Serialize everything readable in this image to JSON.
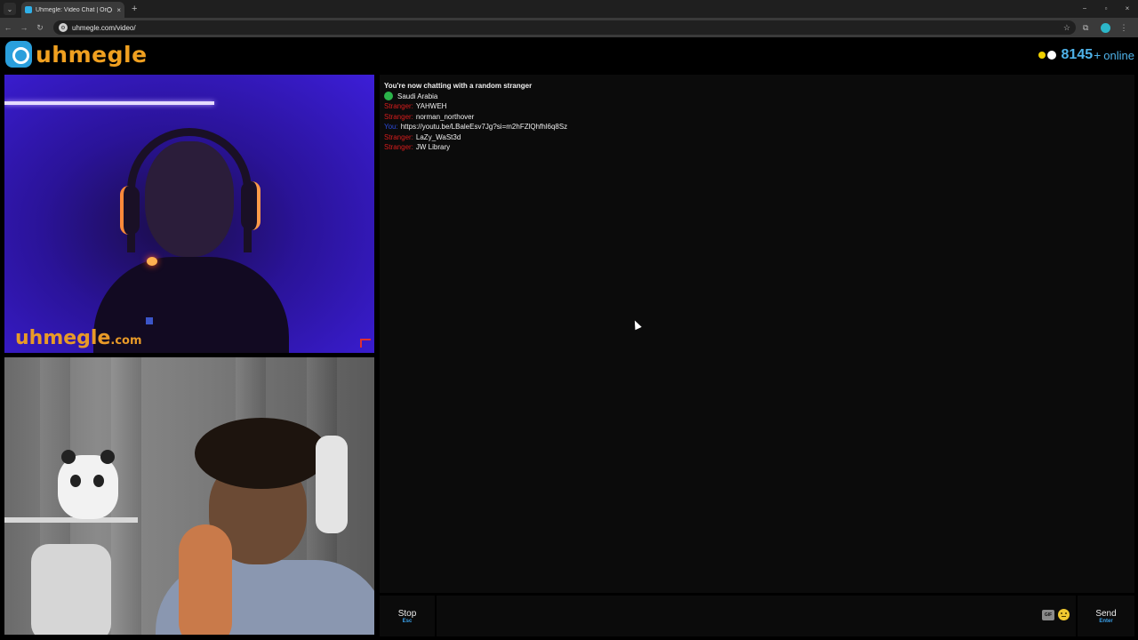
{
  "browser": {
    "tab_title": "Uhmegle: Video Chat | Onl",
    "close_tab_glyph": "×",
    "new_tab_glyph": "+",
    "url": "uhmegle.com/video/",
    "window_controls": [
      "−",
      "▫",
      "×"
    ]
  },
  "site": {
    "logo_text": "uhmegle",
    "online_count": "8145",
    "online_plus": "+",
    "online_label": "online"
  },
  "video": {
    "watermark_main": "uhmegle",
    "watermark_suffix": ".com"
  },
  "chat": {
    "status": "You're now chatting with a random stranger",
    "country": "Saudi Arabia",
    "messages": [
      {
        "who": "Stranger:",
        "text": "YAHWEH"
      },
      {
        "who": "Stranger:",
        "text": "norman_northover"
      },
      {
        "who": "You:",
        "text": "https://youtu.be/LBaleEsv7Jg?si=m2hFZlQhfhl6q8Sz"
      },
      {
        "who": "Stranger:",
        "text": "LaZy_WaSt3d"
      },
      {
        "who": "Stranger:",
        "text": "JW Library"
      }
    ]
  },
  "controls": {
    "stop_label": "Stop",
    "stop_key": "Esc",
    "gif_label": "GIF",
    "send_label": "Send",
    "send_key": "Enter",
    "input_value": ""
  },
  "colors": {
    "brand_orange": "#f0a020",
    "online_blue": "#4fb3ea",
    "stranger_red": "#d81c1c",
    "you_blue": "#2c4ad8"
  }
}
